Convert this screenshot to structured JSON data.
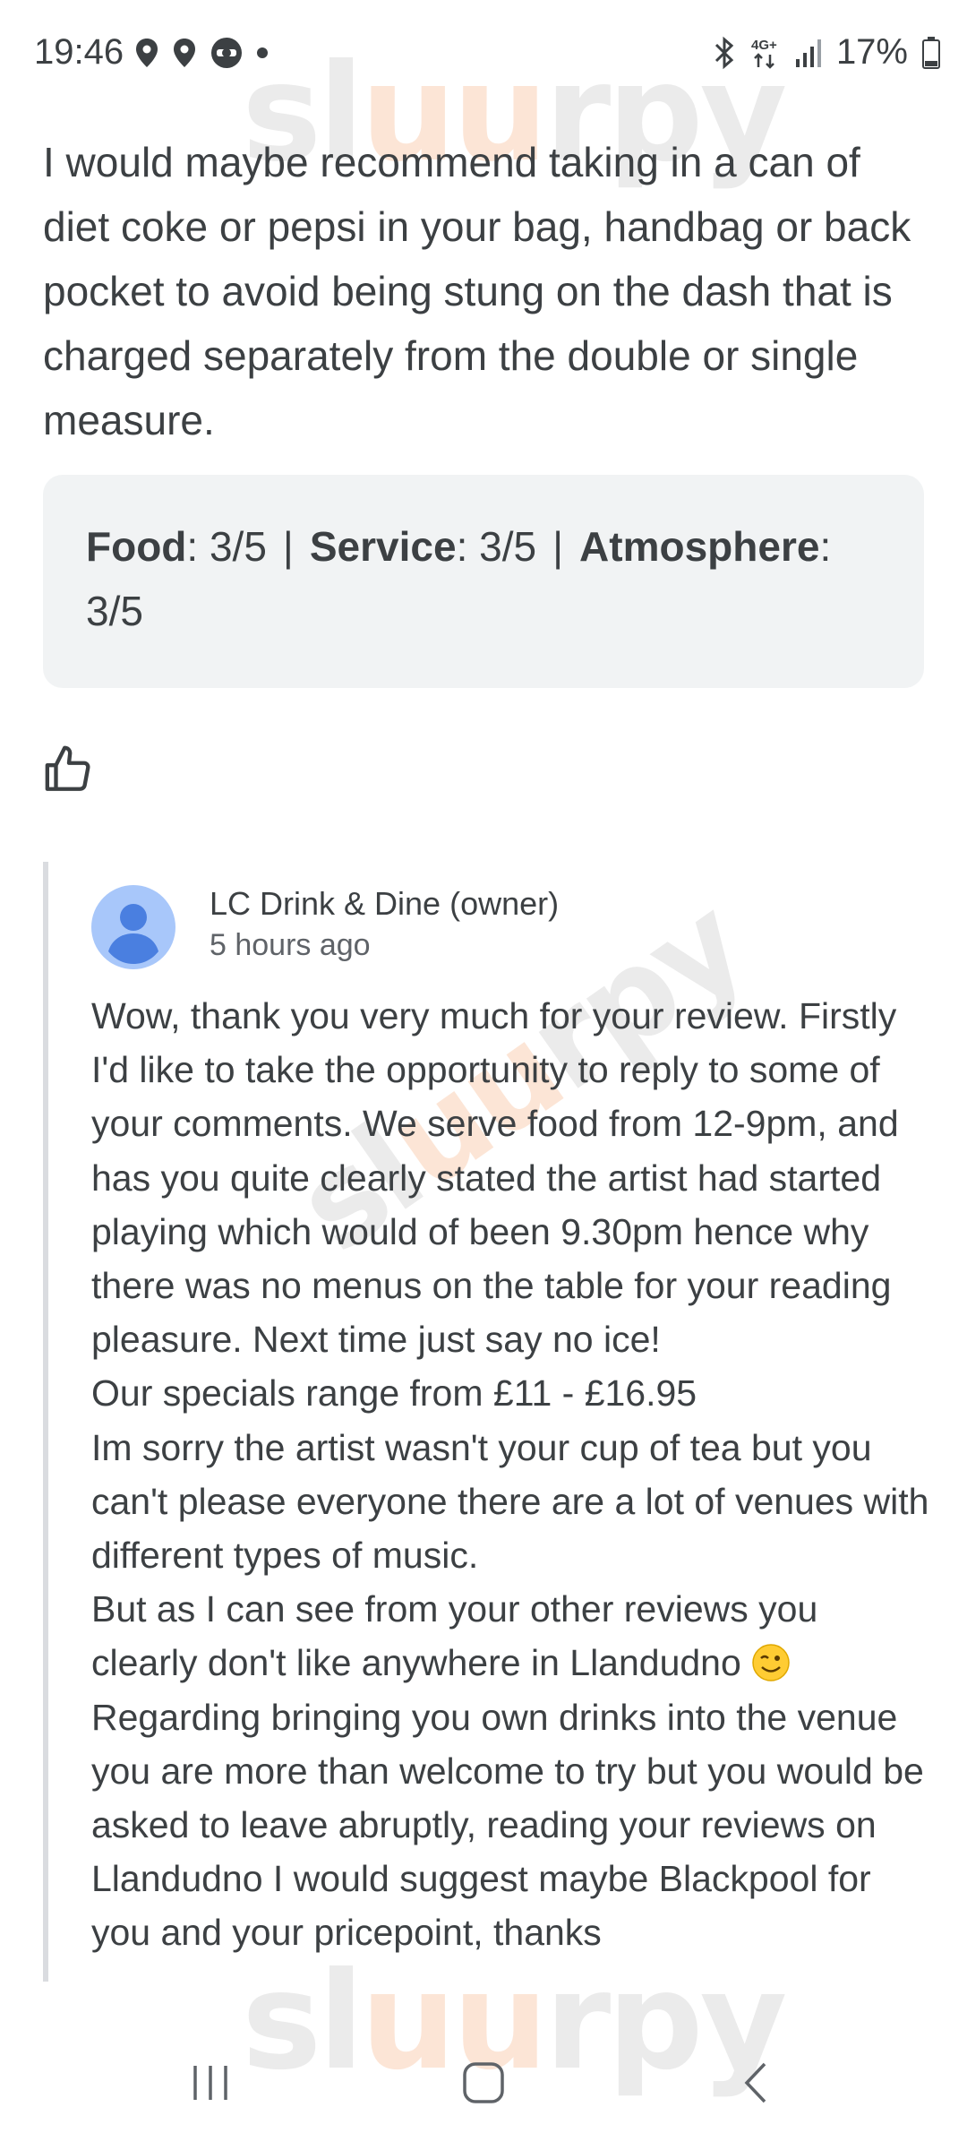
{
  "status_bar": {
    "time": "19:46",
    "battery": "17%",
    "left_icons": [
      "location-icon",
      "location-icon",
      "sync-icon",
      "dot-icon"
    ],
    "right_icons": [
      "bluetooth-icon",
      "4g-icon",
      "signal-icon",
      "battery-icon"
    ]
  },
  "watermark": {
    "text": "sluurpy"
  },
  "review": {
    "text": "I would maybe recommend taking in a can of diet coke or pepsi in your bag, handbag or back pocket to avoid being stung on the dash that is charged separately from the double or single measure.",
    "ratings": {
      "food_label": "Food",
      "food_value": ": 3/5",
      "service_label": "Service",
      "service_value": ": 3/5",
      "atmosphere_label": "Atmosphere",
      "atmosphere_value": ": 3/5",
      "separator": "|"
    },
    "like_icon": "thumbs-up-icon"
  },
  "owner_reply": {
    "name": "LC Drink & Dine (owner)",
    "time": "5 hours ago",
    "text_part1": "Wow, thank you very much for your review. Firstly I'd like to take the opportunity to reply to some of your comments. We serve food from 12-9pm, and has you quite clearly stated the artist had started playing which would of been 9.30pm hence why there was no menus on the table for your reading pleasure. Next time just say no ice!\nOur specials range from £11 - £16.95\nIm sorry the artist wasn't your cup of tea but you can't please everyone there are a lot of venues with different types of music.\nBut as I can see from your other reviews you clearly don't like anywhere in Llandudno ",
    "text_part2": "\nRegarding bringing you own drinks into the venue you are more than welcome to try but you would be asked to leave abruptly, reading your reviews on Llandudno I would suggest maybe Blackpool for you and your pricepoint, thanks",
    "emoji": "winking-face-icon"
  },
  "nav_bar": {
    "buttons": [
      "recent-apps-icon",
      "home-icon",
      "back-icon"
    ]
  },
  "colors": {
    "text": "#3c4043",
    "secondary_text": "#5f6368",
    "ratings_bg": "#f1f3f4",
    "reply_bar": "#dadce0",
    "avatar": "#4285f4"
  }
}
